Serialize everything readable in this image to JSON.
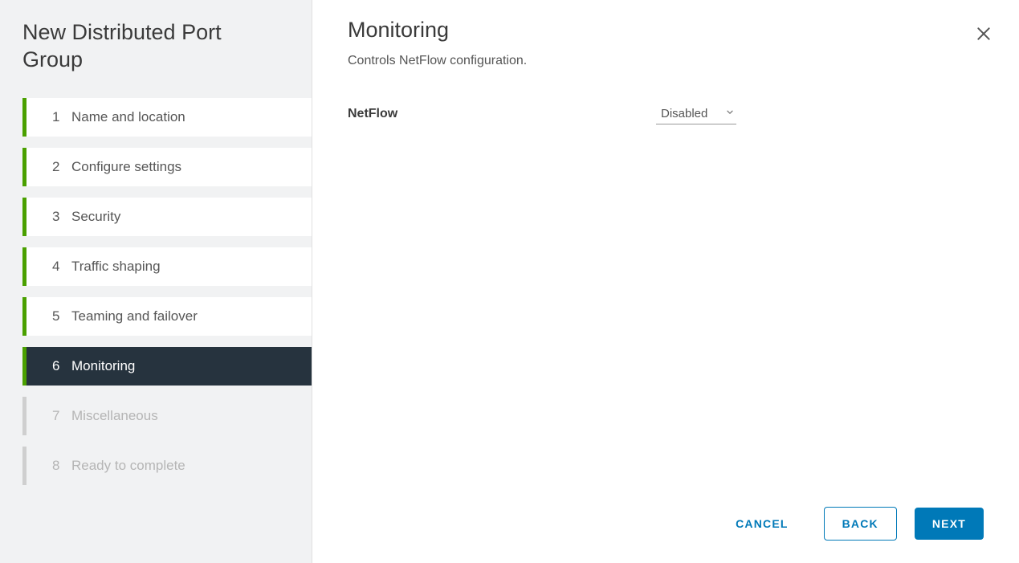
{
  "sidebar": {
    "title": "New Distributed Port Group",
    "steps": [
      {
        "num": "1",
        "label": "Name and location",
        "state": "done"
      },
      {
        "num": "2",
        "label": "Configure settings",
        "state": "done"
      },
      {
        "num": "3",
        "label": "Security",
        "state": "done"
      },
      {
        "num": "4",
        "label": "Traffic shaping",
        "state": "done"
      },
      {
        "num": "5",
        "label": "Teaming and failover",
        "state": "done"
      },
      {
        "num": "6",
        "label": "Monitoring",
        "state": "active"
      },
      {
        "num": "7",
        "label": "Miscellaneous",
        "state": "future"
      },
      {
        "num": "8",
        "label": "Ready to complete",
        "state": "future"
      }
    ]
  },
  "main": {
    "title": "Monitoring",
    "subtitle": "Controls NetFlow configuration.",
    "form": {
      "netflow_label": "NetFlow",
      "netflow_value": "Disabled"
    }
  },
  "footer": {
    "cancel": "CANCEL",
    "back": "BACK",
    "next": "NEXT"
  }
}
